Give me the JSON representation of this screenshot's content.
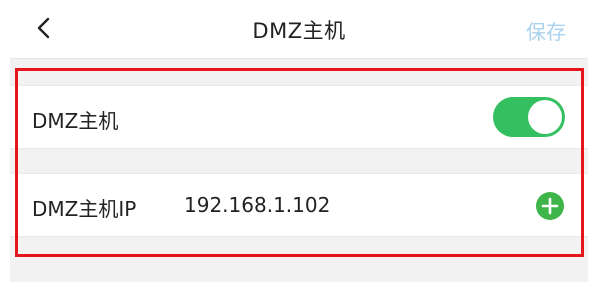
{
  "header": {
    "title": "DMZ主机",
    "save_label": "保存"
  },
  "settings": {
    "dmz_host": {
      "label": "DMZ主机",
      "enabled": true
    },
    "dmz_ip": {
      "label": "DMZ主机IP",
      "value": "192.168.1.102"
    }
  },
  "colors": {
    "toggle_on": "#34c060",
    "add_button": "#3fb549",
    "save_text": "#a9d2ee",
    "highlight_border": "#e8141b"
  },
  "icons": {
    "back": "chevron-left-icon",
    "add": "plus-circle-icon"
  }
}
